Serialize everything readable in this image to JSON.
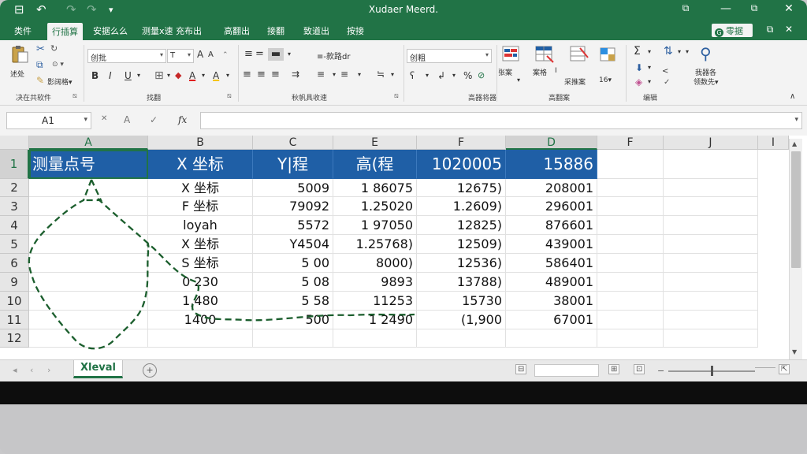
{
  "window": {
    "title": "Xudaer Meerd.",
    "save_glyph": "⊟",
    "undo_glyph": "↶",
    "redo_glyph": "↷",
    "qat_more_glyph": "▾",
    "restore_glyph": "⧉",
    "close_glyph": "✕",
    "ribbon_close_glyph": "✕"
  },
  "tabs": [
    {
      "label": "类件"
    },
    {
      "label": "行插算"
    },
    {
      "label": "安据么么"
    },
    {
      "label": "测量x速 充布出"
    },
    {
      "label": "高翻出"
    },
    {
      "label": "接翻"
    },
    {
      "label": "致道出"
    },
    {
      "label": "按接"
    }
  ],
  "share": {
    "label": "零据"
  },
  "ribbon": {
    "clipboard": {
      "paste_label": "述处",
      "format_painter_label": "影阔格▾",
      "group_label": "决在共软件"
    },
    "font": {
      "font_name": "创批",
      "font_size": "T",
      "grow_label": "A",
      "shrink_label": "A",
      "bold_label": "B",
      "italic_label": "I",
      "underline_label": "U",
      "border_glyph": "⊞",
      "fill_label": "A",
      "color_label": "A",
      "group_label": "找翻"
    },
    "alignment": {
      "wrap_label": "≡-款路dr",
      "group_label": "秋帆具收速"
    },
    "number": {
      "format_value": "创粗",
      "percent_label": "%",
      "comma_label": "%",
      "group_label": "高器将器"
    },
    "styles": {
      "conditional_label": "张案",
      "table_label": "案格",
      "cell_label": "采推案",
      "cell_styles_label": "16▾",
      "table_style_label": "I"
    },
    "cells": {
      "group_label": "高翻案"
    },
    "editing": {
      "sort_label": "我器各",
      "find_label": "领数先▾"
    },
    "collapse_glyph": "∧"
  },
  "formula_bar": {
    "name_box": "A1",
    "cancel_glyph": "✕",
    "enter_glyph": "A",
    "check_glyph": "✓",
    "fx_label": "fx",
    "value": ""
  },
  "grid": {
    "columns": [
      "A",
      "B",
      "C",
      "E",
      "F",
      "D",
      "F",
      "J",
      "I"
    ],
    "rows": [
      "1",
      "2",
      "3",
      "4",
      "5",
      "6",
      "9",
      "10",
      "11",
      "12"
    ],
    "header_row": [
      "测量点号",
      "X 坐标",
      "Y|程",
      "高(程",
      "1020005",
      "15886"
    ],
    "data": [
      [
        "",
        "X 坐标",
        "5009",
        "1 86075",
        "12675)",
        "208001"
      ],
      [
        "",
        "F 坐标",
        "79092",
        "1.25020",
        "1.2609)",
        "296001"
      ],
      [
        "",
        "loyah",
        "5572",
        "1 97050",
        "12825)",
        "876601"
      ],
      [
        "",
        "X 坐标",
        "Y4504",
        "1.25768)",
        "12509)",
        "439001"
      ],
      [
        "",
        "S 坐标",
        "5 00",
        "8000)",
        "12536)",
        "586401"
      ],
      [
        "",
        "0 230",
        "5 08",
        "9893",
        "13788)",
        "489001"
      ],
      [
        "",
        "1,480",
        "5 58",
        "11253",
        "15730",
        "38001"
      ],
      [
        "",
        "1400",
        "500",
        "1 2490",
        "(1,900",
        "67001"
      ],
      [
        "",
        "",
        "",
        "",
        "",
        ""
      ]
    ],
    "annotation_color": "#1b5e2d",
    "header_fill_color": "#1f5fa6"
  },
  "sheets": {
    "active": "Xleval",
    "add_glyph": "+"
  },
  "status": {
    "page_layout_glyph": "⊟",
    "normal_glyph": "⊞",
    "page_break_glyph": "⊡",
    "zoom_glyph": "⇱",
    "zoom_level": 0.5
  }
}
